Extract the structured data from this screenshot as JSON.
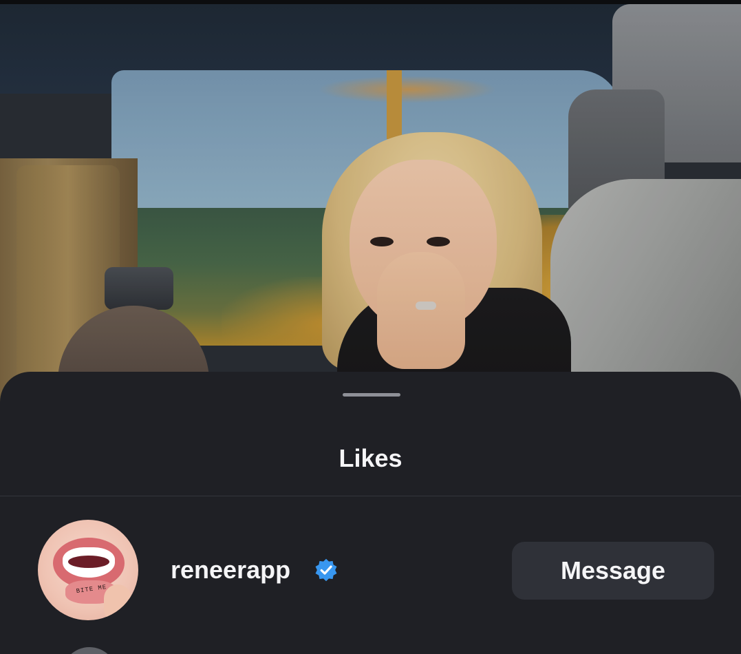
{
  "sheet": {
    "title": "Likes"
  },
  "likes": [
    {
      "username": "reneerapp",
      "verified": true,
      "avatar_caption": "BITE ME",
      "action_label": "Message"
    }
  ],
  "icons": {
    "verified": "verified-badge-icon"
  },
  "colors": {
    "sheet_background": "#1f2025",
    "verified_blue": "#3897f0",
    "button_background": "#2f3138",
    "text": "#f5f5f7"
  }
}
